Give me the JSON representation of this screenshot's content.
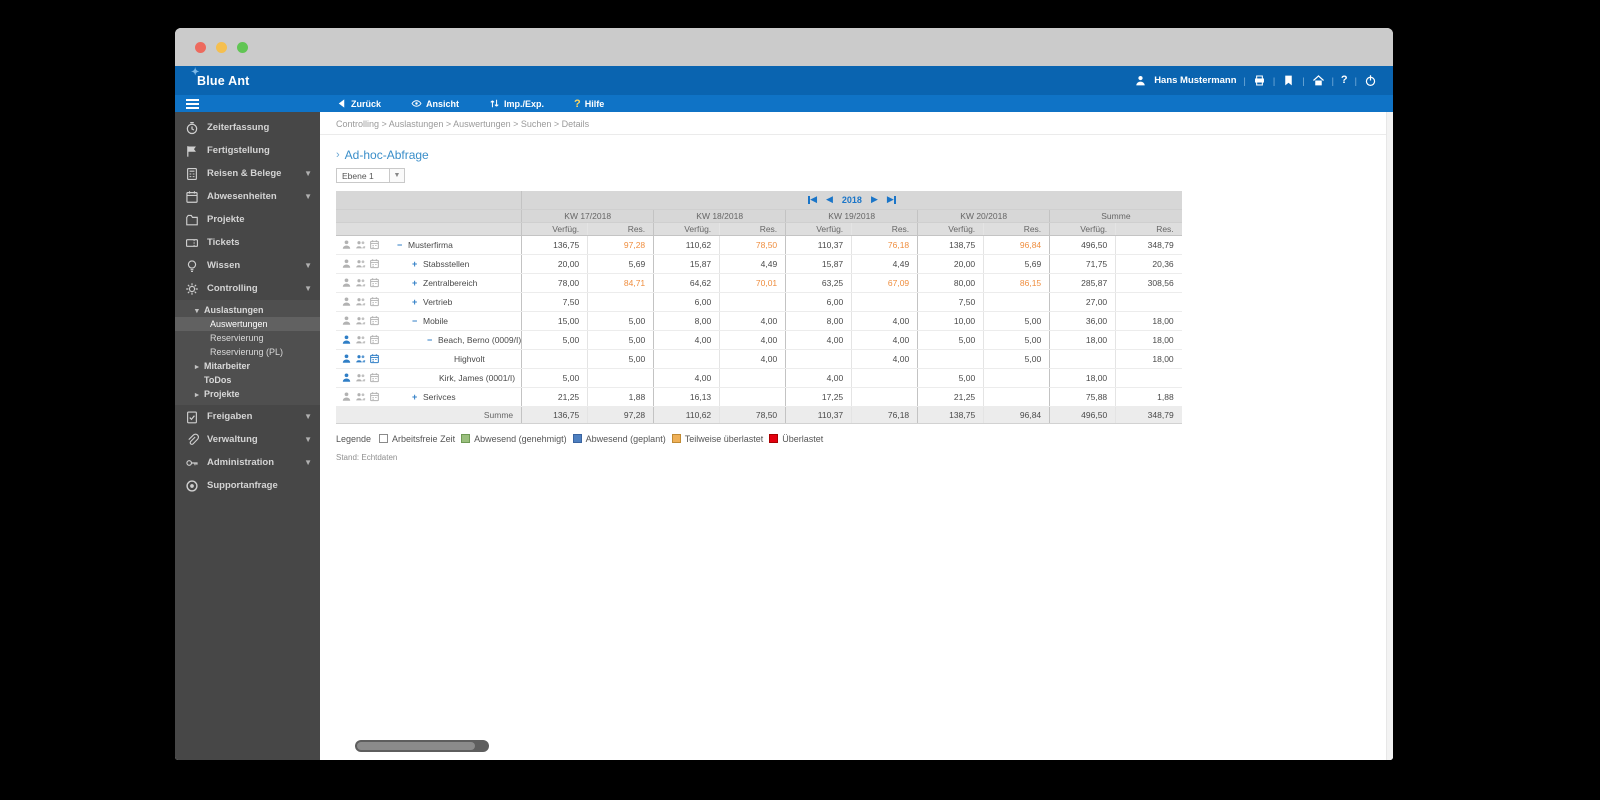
{
  "header": {
    "logo": "Blue Ant",
    "user_name": "Hans Mustermann"
  },
  "toolbar": {
    "items": [
      {
        "label": "Zurück",
        "icon": "back"
      },
      {
        "label": "Ansicht",
        "icon": "eye"
      },
      {
        "label": "Imp./Exp.",
        "icon": "impexp"
      },
      {
        "label": "Hilfe",
        "icon": "help"
      }
    ]
  },
  "breadcrumb": "Controlling > Auslastungen > Auswertungen > Suchen > Details",
  "sidebar": {
    "items": [
      {
        "label": "Zeiterfassung",
        "icon": "clock"
      },
      {
        "label": "Fertigstellung",
        "icon": "flag"
      },
      {
        "label": "Reisen & Belege",
        "icon": "calculator",
        "chevron": true
      },
      {
        "label": "Abwesenheiten",
        "icon": "calendar",
        "chevron": true
      },
      {
        "label": "Projekte",
        "icon": "folder"
      },
      {
        "label": "Tickets",
        "icon": "ticket"
      },
      {
        "label": "Wissen",
        "icon": "bulb",
        "chevron": true
      },
      {
        "label": "Controlling",
        "icon": "gear",
        "chevron": true,
        "expanded": true,
        "submenu": [
          {
            "label": "Auslastungen",
            "marker": "▾",
            "children": [
              "Auswertungen",
              "Reservierung",
              "Reservierung (PL)"
            ],
            "active_child": "Auswertungen"
          },
          {
            "label": "Mitarbeiter",
            "marker": "▸"
          },
          {
            "label": "ToDos",
            "marker": ""
          },
          {
            "label": "Projekte",
            "marker": "▸"
          }
        ]
      },
      {
        "label": "Freigaben",
        "icon": "clipboard",
        "chevron": true
      },
      {
        "label": "Verwaltung",
        "icon": "paperclip",
        "chevron": true
      },
      {
        "label": "Administration",
        "icon": "key",
        "chevron": true
      },
      {
        "label": "Supportanfrage",
        "icon": "support"
      }
    ]
  },
  "main": {
    "title": "Ad-hoc-Abfrage",
    "level_select": {
      "value": "Ebene 1"
    },
    "pagination": {
      "year": "2018"
    },
    "table": {
      "column_groups": [
        "KW 17/2018",
        "KW 18/2018",
        "KW 19/2018",
        "KW 20/2018",
        "Summe"
      ],
      "sub_columns": [
        "Verfüg.",
        "Res."
      ],
      "rows": [
        {
          "label": "Musterfirma",
          "expander": "−",
          "level": 0,
          "active_icons": [
            false,
            false,
            false
          ],
          "values": [
            "136,75",
            "97,28",
            "110,62",
            "78,50",
            "110,37",
            "76,18",
            "138,75",
            "96,84",
            "496,50",
            "348,79"
          ],
          "orange": [
            1,
            3,
            5,
            7
          ]
        },
        {
          "label": "Stabsstellen",
          "expander": "+",
          "level": 1,
          "active_icons": [
            false,
            false,
            false
          ],
          "values": [
            "20,00",
            "5,69",
            "15,87",
            "4,49",
            "15,87",
            "4,49",
            "20,00",
            "5,69",
            "71,75",
            "20,36"
          ],
          "orange": []
        },
        {
          "label": "Zentralbereich",
          "expander": "+",
          "level": 1,
          "active_icons": [
            false,
            false,
            false
          ],
          "values": [
            "78,00",
            "84,71",
            "64,62",
            "70,01",
            "63,25",
            "67,09",
            "80,00",
            "86,15",
            "285,87",
            "308,56"
          ],
          "orange": [
            1,
            3,
            5,
            7
          ]
        },
        {
          "label": "Vertrieb",
          "expander": "+",
          "level": 1,
          "active_icons": [
            false,
            false,
            false
          ],
          "values": [
            "7,50",
            "",
            "6,00",
            "",
            "6,00",
            "",
            "7,50",
            "",
            "27,00",
            ""
          ],
          "orange": []
        },
        {
          "label": "Mobile",
          "expander": "−",
          "level": 1,
          "active_icons": [
            false,
            false,
            false
          ],
          "values": [
            "15,00",
            "5,00",
            "8,00",
            "4,00",
            "8,00",
            "4,00",
            "10,00",
            "5,00",
            "36,00",
            "18,00"
          ],
          "orange": []
        },
        {
          "label": "Beach, Berno (0009/I)",
          "expander": "−",
          "level": 2,
          "active_icons": [
            true,
            false,
            false
          ],
          "values": [
            "5,00",
            "5,00",
            "4,00",
            "4,00",
            "4,00",
            "4,00",
            "5,00",
            "5,00",
            "18,00",
            "18,00"
          ],
          "orange": []
        },
        {
          "label": "Highvolt",
          "expander": "",
          "level": 3,
          "active_icons": [
            true,
            true,
            true
          ],
          "values": [
            "",
            "5,00",
            "",
            "4,00",
            "",
            "4,00",
            "",
            "5,00",
            "",
            "18,00"
          ],
          "orange": []
        },
        {
          "label": "Kirk, James (0001/I)",
          "expander": "",
          "level": 2,
          "active_icons": [
            true,
            false,
            false
          ],
          "values": [
            "5,00",
            "",
            "4,00",
            "",
            "4,00",
            "",
            "5,00",
            "",
            "18,00",
            ""
          ],
          "orange": []
        },
        {
          "label": "Serivces",
          "expander": "+",
          "level": 1,
          "active_icons": [
            false,
            false,
            false
          ],
          "values": [
            "21,25",
            "1,88",
            "16,13",
            "",
            "17,25",
            "",
            "21,25",
            "",
            "75,88",
            "1,88"
          ],
          "orange": []
        }
      ],
      "summary": {
        "label": "Summe",
        "values": [
          "136,75",
          "97,28",
          "110,62",
          "78,50",
          "110,37",
          "76,18",
          "138,75",
          "96,84",
          "496,50",
          "348,79"
        ]
      }
    },
    "legend": {
      "title": "Legende",
      "items": [
        {
          "label": "Arbeitsfreie Zeit",
          "color": "#ffffff",
          "border": "#8a8a8a"
        },
        {
          "label": "Abwesend (genehmigt)",
          "color": "#9abf7d",
          "border": "#6f9a55"
        },
        {
          "label": "Abwesend (geplant)",
          "color": "#4d7fc0",
          "border": "#3a64a0"
        },
        {
          "label": "Teilweise überlastet",
          "color": "#efb057",
          "border": "#c08a34"
        },
        {
          "label": "Überlastet",
          "color": "#e3000f",
          "border": "#a80000"
        }
      ]
    },
    "status": "Stand: Echtdaten"
  }
}
